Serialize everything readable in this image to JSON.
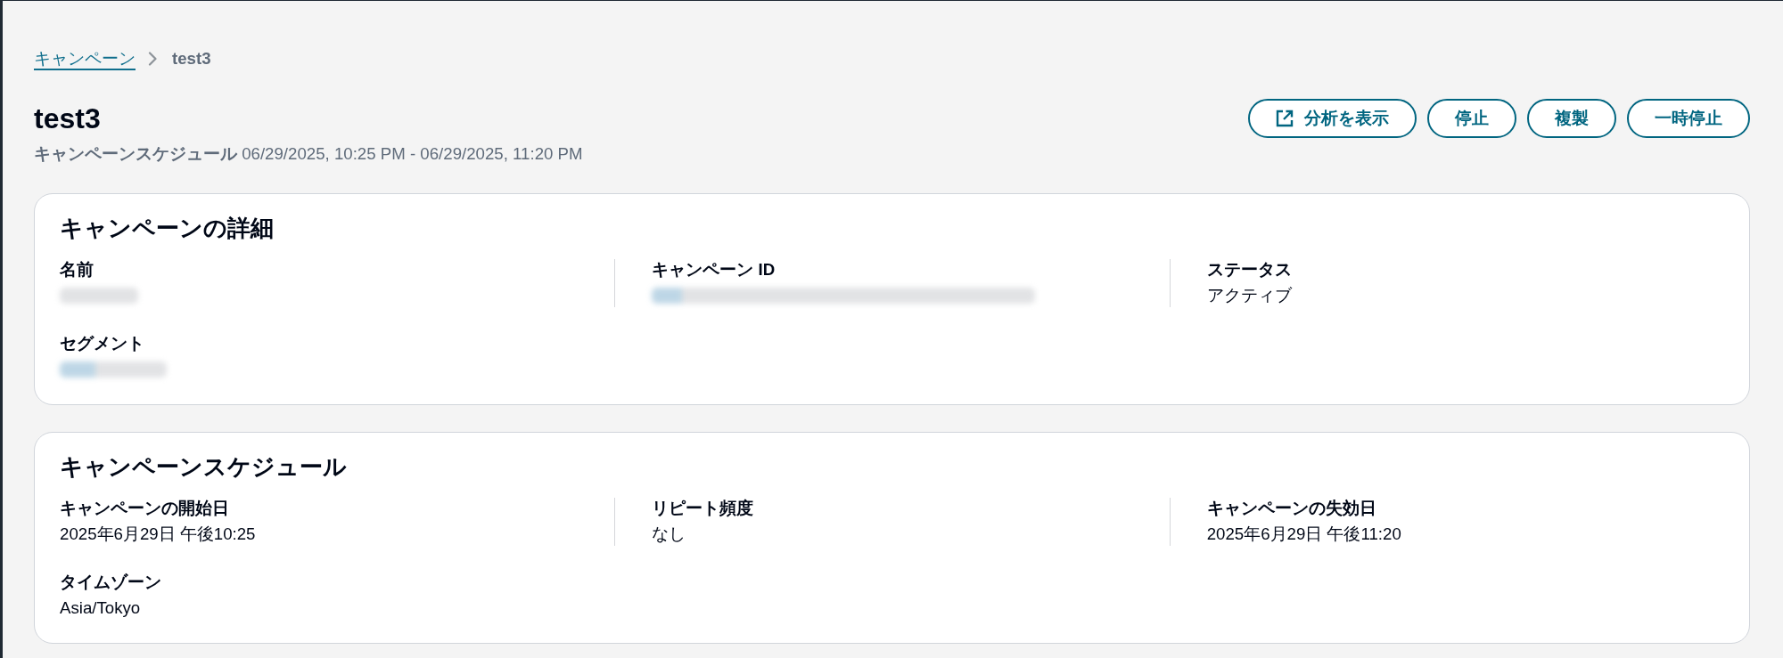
{
  "breadcrumbs": [
    {
      "kind": "link",
      "label": "キャンペーン"
    },
    {
      "kind": "current",
      "label": "test3"
    }
  ],
  "header": {
    "title": "test3",
    "summary": "**キャンペーンスケジュール** 06/29/2025, 10:25 PM - 06/29/2025, 11:20 PM",
    "actions": [
      {
        "kind": "external-link",
        "label": "分析を表示"
      },
      {
        "kind": "plain",
        "label": "停止"
      },
      {
        "kind": "plain",
        "label": "複製"
      },
      {
        "kind": "plain",
        "label": "一時停止"
      }
    ]
  },
  "details": {
    "title": "キャンペーンの詳細",
    "columns": [
      {
        "fields": [
          {
            "label": "名前",
            "kind": "blurred"
          },
          {
            "label": "セグメント",
            "kind": "blurred-link"
          }
        ]
      },
      {
        "fields": [
          {
            "label": "キャンペーン ID",
            "kind": "blurred-id"
          }
        ]
      },
      {
        "fields": [
          {
            "label": "ステータス",
            "kind": "text",
            "value": "アクティブ"
          }
        ]
      }
    ]
  },
  "schedule": {
    "title": "キャンペーンスケジュール",
    "columns": [
      {
        "fields": [
          {
            "label": "キャンペーンの開始日",
            "kind": "text",
            "value": "2025年6月29日 午後10:25"
          },
          {
            "label": "タイムゾーン",
            "kind": "text",
            "value": "Asia/Tokyo"
          }
        ]
      },
      {
        "fields": [
          {
            "label": "リピート頻度",
            "kind": "text",
            "value": "なし"
          }
        ]
      },
      {
        "fields": [
          {
            "label": "キャンペーンの失効日",
            "kind": "text",
            "value": "2025年6月29日 午後11:20"
          }
        ]
      }
    ]
  }
}
